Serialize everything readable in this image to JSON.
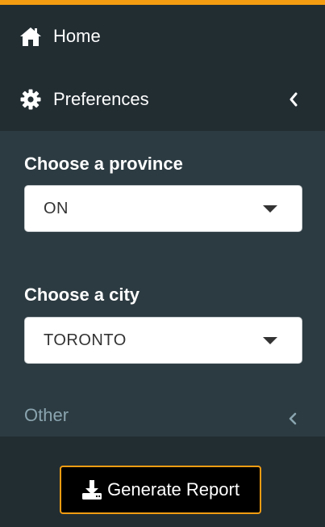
{
  "colors": {
    "accent": "#f39c12",
    "sidebar_bg": "#222d32",
    "submenu_bg": "#2c3b41",
    "muted_text": "#8aa4af"
  },
  "menu": {
    "home": {
      "label": "Home",
      "icon": "home-icon"
    },
    "preferences": {
      "label": "Preferences",
      "icon": "gear-icon"
    }
  },
  "preferences": {
    "province": {
      "label": "Choose a province",
      "value": "ON"
    },
    "city": {
      "label": "Choose a city",
      "value": "TORONTO"
    },
    "other": {
      "label": "Other"
    }
  },
  "actions": {
    "generate_report": {
      "label": "Generate Report",
      "icon": "download-icon"
    }
  }
}
